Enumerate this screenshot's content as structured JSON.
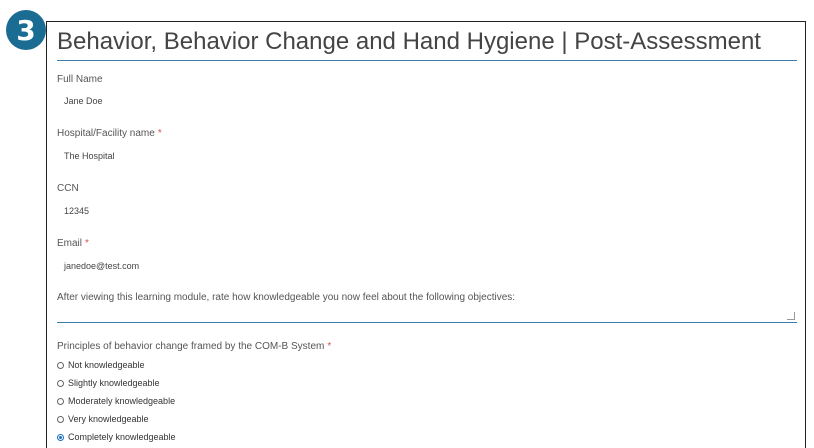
{
  "step_badge": "3",
  "form": {
    "title": "Behavior, Behavior Change and Hand Hygiene | Post-Assessment",
    "fields": [
      {
        "label": "Full Name",
        "required": "",
        "value": "Jane Doe"
      },
      {
        "label": "Hospital/Facility name",
        "required": "*",
        "value": "The Hospital"
      },
      {
        "label": "CCN",
        "required": "",
        "value": "12345"
      },
      {
        "label": "Email",
        "required": "*",
        "value": "janedoe@test.com"
      }
    ],
    "objectives_prompt": "After viewing this learning module, rate how knowledgeable you now feel about the following objectives:",
    "question": {
      "label": "Principles of behavior change framed by the COM-B System",
      "required": "*",
      "options": [
        {
          "label": "Not knowledgeable",
          "checked": false
        },
        {
          "label": "Slightly knowledgeable",
          "checked": false
        },
        {
          "label": "Moderately knowledgeable",
          "checked": false
        },
        {
          "label": "Very knowledgeable",
          "checked": false
        },
        {
          "label": "Completely knowledgeable",
          "checked": true
        }
      ]
    }
  },
  "colors": {
    "accent": "#3a7fb0",
    "badge": "#1b6c92",
    "required": "#d9534f"
  }
}
